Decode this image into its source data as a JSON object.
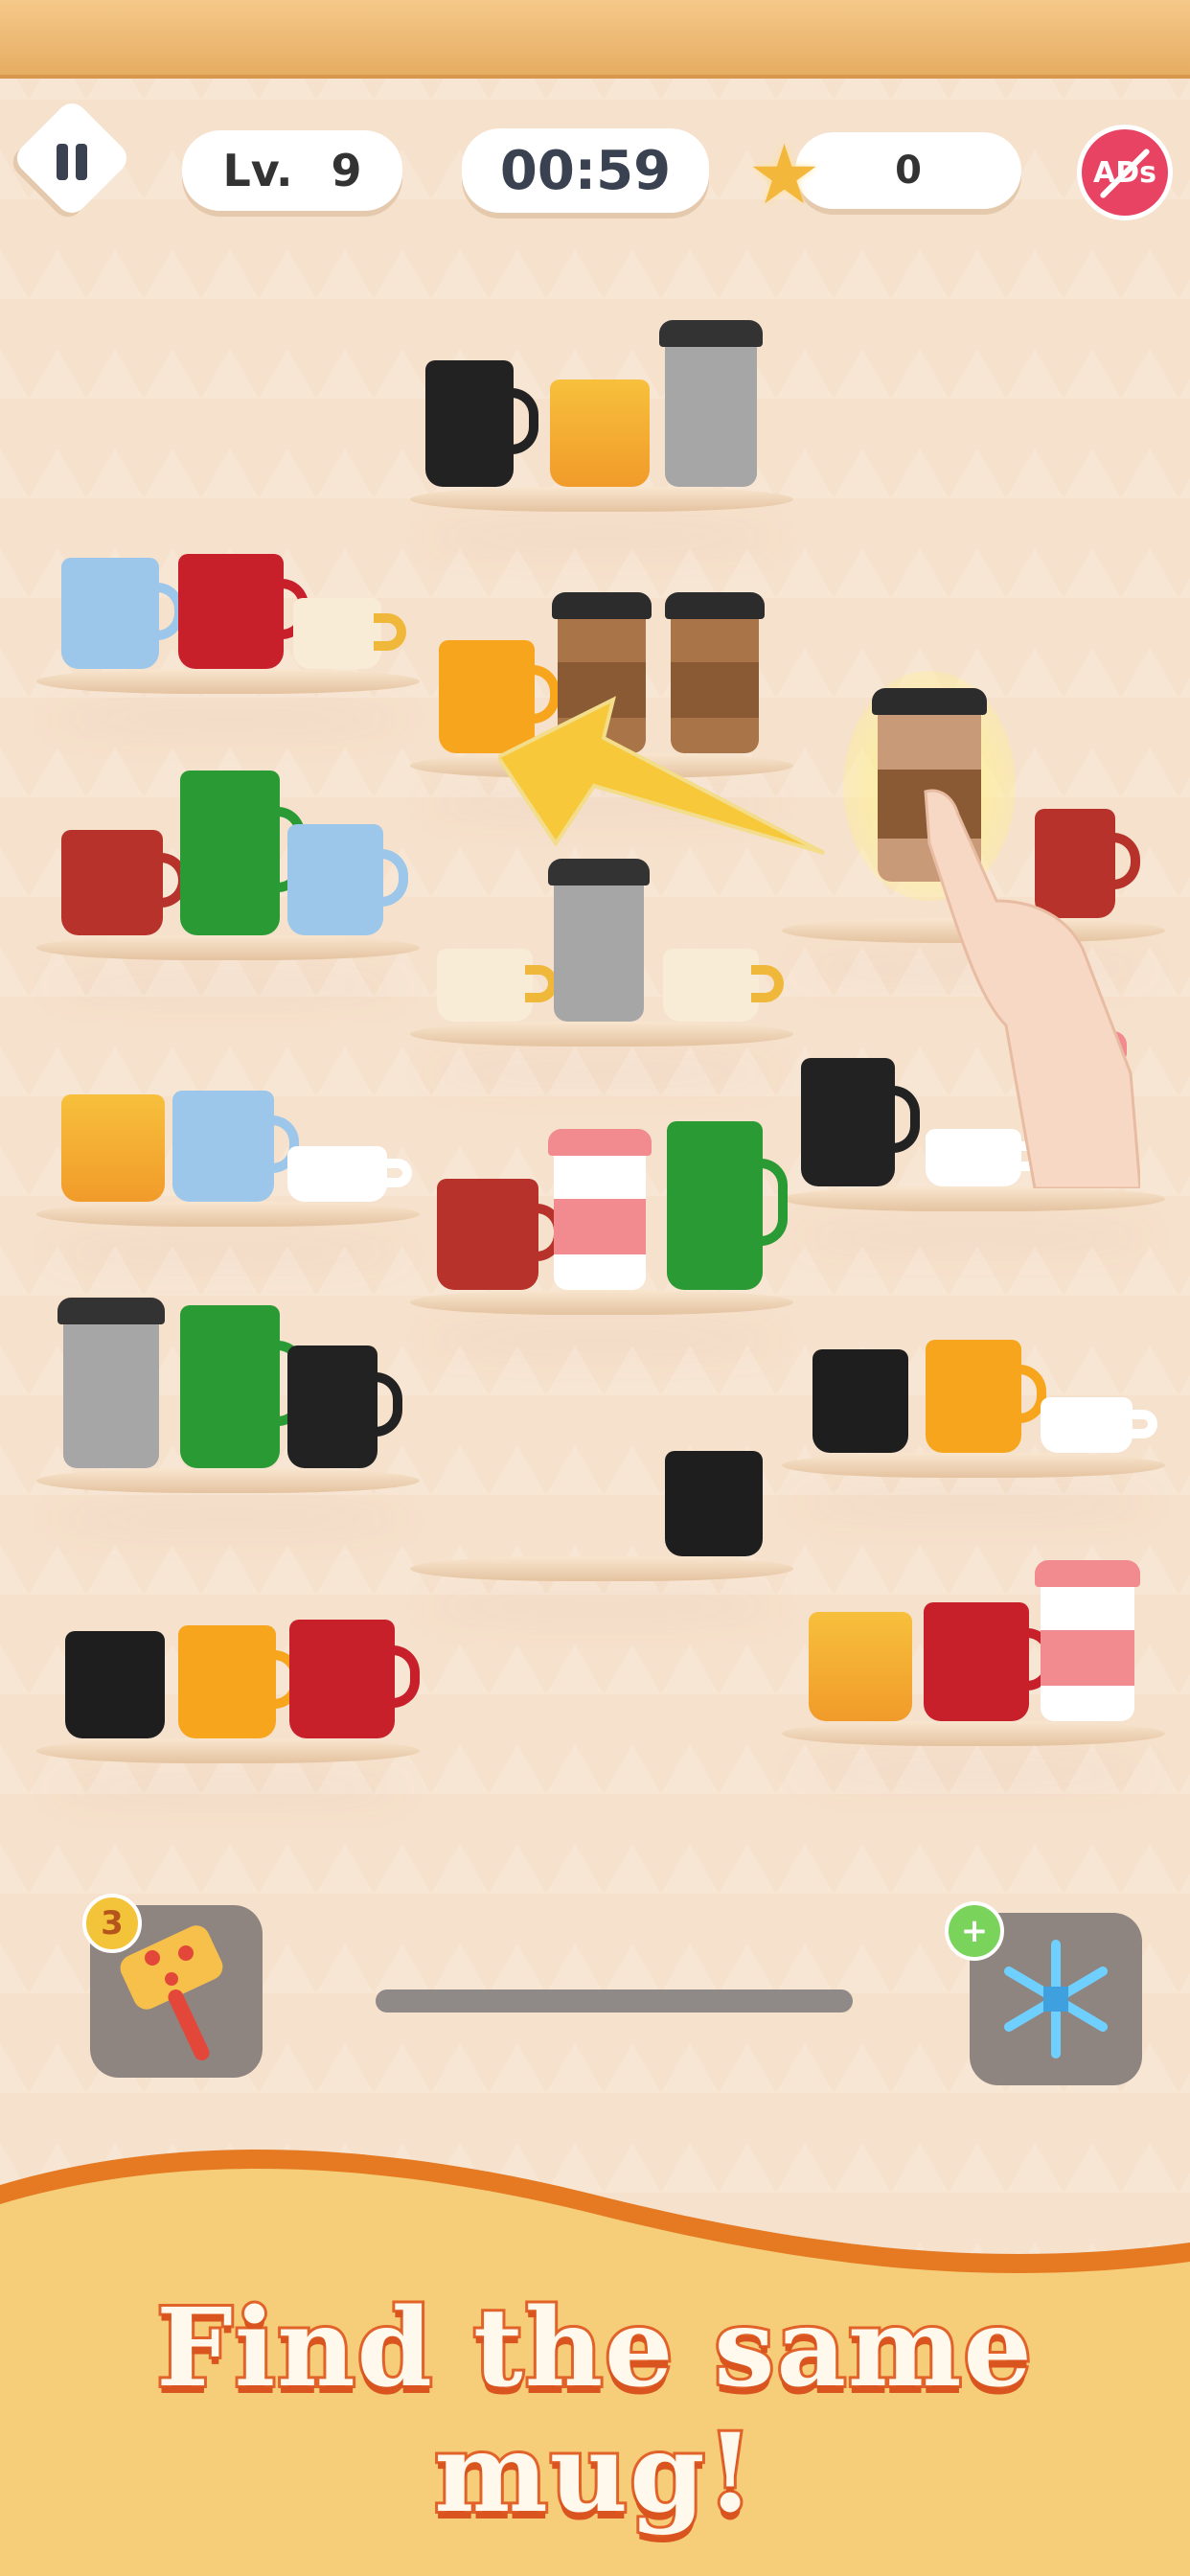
{
  "hud": {
    "level_label": "Lv.",
    "level_value": "9",
    "timer": "00:59",
    "stars": "0",
    "no_ads_label": "ADs"
  },
  "boosters": {
    "hammer_count": "3",
    "freeze_add": "+"
  },
  "banner_text": "Find the same mug!",
  "colors": {
    "accent_orange": "#e2632a",
    "ads_red": "#e94363",
    "hud_text": "#3a4150"
  },
  "icons": [
    "pause-icon",
    "star-icon",
    "no-ads-icon",
    "hammer-icon",
    "snowflake-icon",
    "hand-pointer-icon",
    "arrow-icon"
  ]
}
